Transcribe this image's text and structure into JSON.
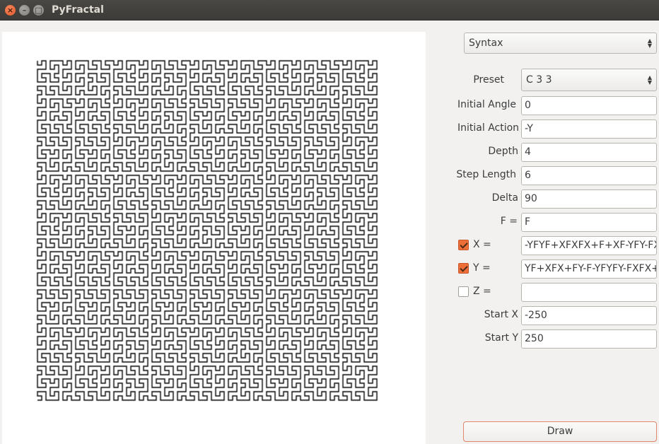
{
  "window": {
    "title": "PyFractal"
  },
  "mode_select": {
    "value": "Syntax"
  },
  "form": {
    "preset_label": "Preset",
    "preset_value": "C 3 3",
    "initial_angle_label": "Initial Angle",
    "initial_angle_value": "0",
    "initial_action_label": "Initial Action",
    "initial_action_value": "-Y",
    "depth_label": "Depth",
    "depth_value": "4",
    "step_length_label": "Step Length",
    "step_length_value": "6",
    "delta_label": "Delta",
    "delta_value": "90",
    "f_label": "F =",
    "f_value": "F",
    "x_label": "X =",
    "x_checked": true,
    "x_value": "-YFYF+XFXFX+F+XF-YFY-FX",
    "y_label": "Y =",
    "y_checked": true,
    "y_value": "YF+XFX+FY-F-YFYFY-FXFX+",
    "z_label": "Z =",
    "z_checked": false,
    "z_value": "",
    "start_x_label": "Start X",
    "start_x_value": "-250",
    "start_y_label": "Start Y",
    "start_y_value": "250"
  },
  "draw_button": {
    "label": "Draw"
  },
  "colors": {
    "accent": "#ee6e38",
    "line": "#000000",
    "canvas": "#ffffff"
  }
}
